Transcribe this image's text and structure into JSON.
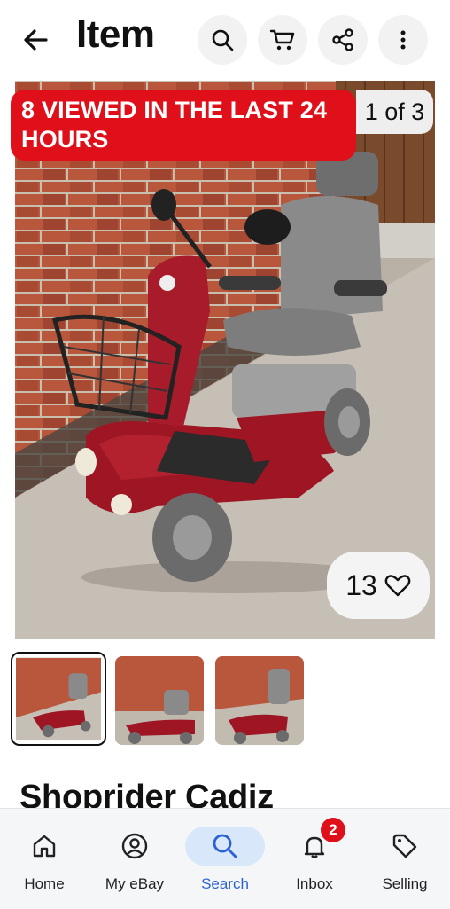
{
  "header": {
    "title": "Item"
  },
  "icons": {
    "back": "arrow-left-icon",
    "search": "search-icon",
    "cart": "cart-icon",
    "share": "share-icon",
    "more": "more-vertical-icon"
  },
  "gallery": {
    "viewed_banner": "8 VIEWED IN THE LAST 24 HOURS",
    "counter": "1 of 3",
    "likes": "13"
  },
  "product": {
    "title": "Shoprider Cadiz"
  },
  "nav": {
    "items": [
      {
        "label": "Home"
      },
      {
        "label": "My eBay"
      },
      {
        "label": "Search"
      },
      {
        "label": "Inbox",
        "badge": "2"
      },
      {
        "label": "Selling"
      }
    ]
  },
  "colors": {
    "accent": "#2a62d6",
    "alert": "#e0101a",
    "scooter": "#9e1524"
  }
}
